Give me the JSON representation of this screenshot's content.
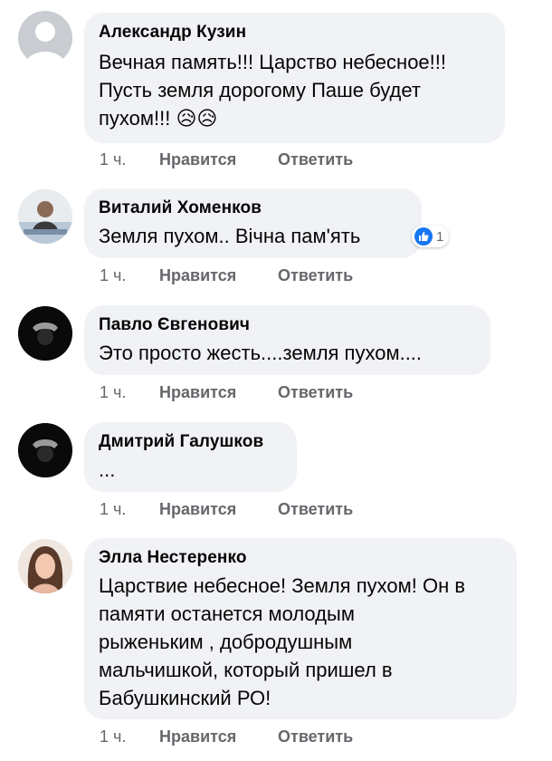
{
  "comments": [
    {
      "author": "Александр Кузин",
      "text": "Вечная память!!!  Царство небесное!!!\nПусть земля дорогому Паше будет\nпухом!!! 😥😥",
      "time": "1 ч.",
      "like": "Нравится",
      "reply": "Ответить"
    },
    {
      "author": "Виталий Хоменков",
      "text": "Земля пухом.. Вічна пам'ять",
      "time": "1 ч.",
      "like": "Нравится",
      "reply": "Ответить",
      "reaction_count": "1"
    },
    {
      "author": "Павло Євгенович",
      "text": "Это просто жесть....земля пухом....",
      "time": "1 ч.",
      "like": "Нравится",
      "reply": "Ответить"
    },
    {
      "author": "Дмитрий Галушков",
      "text": "...",
      "time": "1 ч.",
      "like": "Нравится",
      "reply": "Ответить"
    },
    {
      "author": "Элла Нестеренко",
      "text": "Царствие небесное! Земля пухом! Он в\nпамяти останется молодым\nрыженьким , добродушным\nмальчишкой, который пришел в\nБабушкинский РО!",
      "time": "1 ч.",
      "like": "Нравится",
      "reply": "Ответить"
    }
  ],
  "colors": {
    "bubble": "#f0f2f5",
    "meta": "#65676b",
    "like_badge": "#1877f2"
  }
}
